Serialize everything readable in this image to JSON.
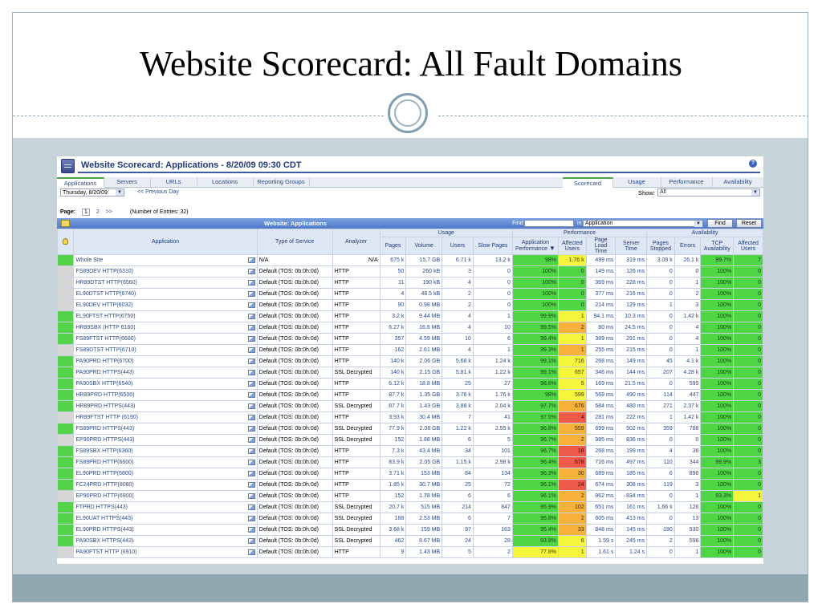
{
  "slide": {
    "title": "Website Scorecard: All Fault Domains"
  },
  "app": {
    "title": "Website Scorecard: Applications - 8/20/09 09:30 CDT",
    "help_icon": "?"
  },
  "tabs": [
    {
      "label": "Applications",
      "active": true
    },
    {
      "label": "Servers"
    },
    {
      "label": "URLs"
    },
    {
      "label": "Locations"
    },
    {
      "label": "Reporting Groups"
    },
    {
      "label": "Scorecard",
      "active": true
    },
    {
      "label": "Usage"
    },
    {
      "label": "Performance"
    },
    {
      "label": "Availability"
    }
  ],
  "toolbar": {
    "date": "Thursday, 8/20/09",
    "prev_day": "<< Previous Day",
    "show_label": "Show:",
    "show_value": "All"
  },
  "pager": {
    "label": "Page:",
    "current": "1",
    "next": "2",
    "more": ">>",
    "entries": "(Number of Entries: 32)"
  },
  "bar": {
    "title": "Website: Applications",
    "find_label": "Find",
    "find_value": "",
    "in_label": "in",
    "in_value": "Application",
    "find_button": "Find",
    "reset_button": "Reset"
  },
  "columns": {
    "groups": {
      "usage": "Usage",
      "performance": "Performance",
      "availability": "Availability"
    },
    "application": "Application",
    "type": "Type of Service",
    "analyzer": "Analyzer",
    "pages": "Pages",
    "volume": "Volume",
    "users": "Users",
    "slow_pages": "Slow Pages",
    "app_perf": "Application Performance",
    "aff_users": "Affected Users",
    "page_load": "Page Load Time",
    "server_time": "Server Time",
    "pages_stopped": "Pages Stopped",
    "errors": "Errors",
    "tcp_avail": "TCP Availability",
    "aff_users2": "Affected Users"
  },
  "colors": {
    "green": "#4fd645",
    "yellow": "#f5f53c",
    "orange": "#f6b13a",
    "red": "#ef5a4a",
    "gray": "#d6d6d6"
  },
  "rows": [
    {
      "ind": "green",
      "app": "Whole Site",
      "type": "N/A",
      "analyzer": "N/A",
      "pages": "675 k",
      "volume": "15.7 GB",
      "users": "6.71 k",
      "slow": "13.2 k",
      "perf": "98%",
      "perf_c": "green",
      "aff": "1.76 k",
      "aff_c": "yellow",
      "load": "499 ms",
      "server": "319 ms",
      "stopped": "3.09 k",
      "errors": "26.1 k",
      "tcp": "99.7%",
      "tcp_c": "green",
      "aff2": "7",
      "aff2_c": "green"
    },
    {
      "ind": "gray",
      "app": "FS89DEV HTTP(6310)",
      "type": "Default (TOS: 0b:0h:0d)",
      "analyzer": "HTTP",
      "pages": "50",
      "volume": "260 kB",
      "users": "3",
      "slow": "0",
      "perf": "100%",
      "perf_c": "green",
      "aff": "0",
      "aff_c": "green",
      "load": "149 ms",
      "server": "126 ms",
      "stopped": "0",
      "errors": "0",
      "tcp": "100%",
      "tcp_c": "green",
      "aff2": "0",
      "aff2_c": "green"
    },
    {
      "ind": "gray",
      "app": "HR89DTST HTTP(6560)",
      "type": "Default (TOS: 0b:0h:0d)",
      "analyzer": "HTTP",
      "pages": "11",
      "volume": "190 kB",
      "users": "4",
      "slow": "0",
      "perf": "100%",
      "perf_c": "green",
      "aff": "0",
      "aff_c": "green",
      "load": "369 ms",
      "server": "228 ms",
      "stopped": "0",
      "errors": "1",
      "tcp": "100%",
      "tcp_c": "green",
      "aff2": "0",
      "aff2_c": "green"
    },
    {
      "ind": "gray",
      "app": "EL90DTST HTTP(6740)",
      "type": "Default (TOS: 0b:0h:0d)",
      "analyzer": "HTTP",
      "pages": "4",
      "volume": "48.5 kB",
      "users": "2",
      "slow": "0",
      "perf": "100%",
      "perf_c": "green",
      "aff": "0",
      "aff_c": "green",
      "load": "377 ms",
      "server": "216 ms",
      "stopped": "0",
      "errors": "2",
      "tcp": "100%",
      "tcp_c": "green",
      "aff2": "0",
      "aff2_c": "green"
    },
    {
      "ind": "gray",
      "app": "EL90DEV HTTP(6032)",
      "type": "Default (TOS: 0b:0h:0d)",
      "analyzer": "HTTP",
      "pages": "90",
      "volume": "0.98 MB",
      "users": "2",
      "slow": "0",
      "perf": "100%",
      "perf_c": "green",
      "aff": "0",
      "aff_c": "green",
      "load": "214 ms",
      "server": "129 ms",
      "stopped": "1",
      "errors": "3",
      "tcp": "100%",
      "tcp_c": "green",
      "aff2": "0",
      "aff2_c": "green"
    },
    {
      "ind": "green",
      "app": "EL90FTST HTTP(6750)",
      "type": "Default (TOS: 0b:0h:0d)",
      "analyzer": "HTTP",
      "pages": "3.2 k",
      "volume": "9.44 MB",
      "users": "4",
      "slow": "1",
      "perf": "99.9%",
      "perf_c": "green",
      "aff": "1",
      "aff_c": "yellow",
      "load": "94.1 ms",
      "server": "10.3 ms",
      "stopped": "0",
      "errors": "1.42 k",
      "tcp": "100%",
      "tcp_c": "green",
      "aff2": "0",
      "aff2_c": "green"
    },
    {
      "ind": "green",
      "app": "HR89SBX (HTTP 6160)",
      "type": "Default (TOS: 0b:0h:0d)",
      "analyzer": "HTTP",
      "pages": "6.27 k",
      "volume": "16.6 MB",
      "users": "4",
      "slow": "10",
      "perf": "99.5%",
      "perf_c": "green",
      "aff": "2",
      "aff_c": "orange",
      "load": "80 ms",
      "server": "24.5 ms",
      "stopped": "0",
      "errors": "4",
      "tcp": "100%",
      "tcp_c": "green",
      "aff2": "0",
      "aff2_c": "green"
    },
    {
      "ind": "green",
      "app": "FS89FTST HTTP(6680)",
      "type": "Default (TOS: 0b:0h:0d)",
      "analyzer": "HTTP",
      "pages": "357",
      "volume": "4.59 MB",
      "users": "10",
      "slow": "6",
      "perf": "99.4%",
      "perf_c": "green",
      "aff": "1",
      "aff_c": "yellow",
      "load": "389 ms",
      "server": "291 ms",
      "stopped": "0",
      "errors": "4",
      "tcp": "100%",
      "tcp_c": "green",
      "aff2": "0",
      "aff2_c": "green"
    },
    {
      "ind": "gray",
      "app": "FS89DTST HTTP(6710)",
      "type": "Default (TOS: 0b:0h:0d)",
      "analyzer": "HTTP",
      "pages": "162",
      "volume": "2.61 MB",
      "users": "4",
      "slow": "1",
      "perf": "99.3%",
      "perf_c": "green",
      "aff": "1",
      "aff_c": "orange",
      "load": "255 ms",
      "server": "215 ms",
      "stopped": "0",
      "errors": "1",
      "tcp": "100%",
      "tcp_c": "green",
      "aff2": "0",
      "aff2_c": "green"
    },
    {
      "ind": "green",
      "app": "PA90PRD HTTP(6700)",
      "type": "Default (TOS: 0b:0h:0d)",
      "analyzer": "HTTP",
      "pages": "140 k",
      "volume": "2.06 GB",
      "users": "5.68 k",
      "slow": "1.24 k",
      "perf": "99.1%",
      "perf_c": "green",
      "aff": "716",
      "aff_c": "yellow",
      "load": "268 ms",
      "server": "149 ms",
      "stopped": "45",
      "errors": "4.1 k",
      "tcp": "100%",
      "tcp_c": "green",
      "aff2": "0",
      "aff2_c": "green"
    },
    {
      "ind": "green",
      "app": "PA90PRD HTTPS(443)",
      "type": "Default (TOS: 0b:0h:0d)",
      "analyzer": "SSL Decrypted",
      "pages": "140 k",
      "volume": "2.15 GB",
      "users": "5.81 k",
      "slow": "1.22 k",
      "perf": "99.1%",
      "perf_c": "green",
      "aff": "657",
      "aff_c": "yellow",
      "load": "346 ms",
      "server": "144 ms",
      "stopped": "207",
      "errors": "4.28 k",
      "tcp": "100%",
      "tcp_c": "green",
      "aff2": "0",
      "aff2_c": "green"
    },
    {
      "ind": "green",
      "app": "PA90SBX HTTP(6540)",
      "type": "Default (TOS: 0b:0h:0d)",
      "analyzer": "HTTP",
      "pages": "6.12 k",
      "volume": "18.8 MB",
      "users": "25",
      "slow": "27",
      "perf": "98.6%",
      "perf_c": "green",
      "aff": "5",
      "aff_c": "yellow",
      "load": "169 ms",
      "server": "21.5 ms",
      "stopped": "0",
      "errors": "595",
      "tcp": "100%",
      "tcp_c": "green",
      "aff2": "0",
      "aff2_c": "green"
    },
    {
      "ind": "green",
      "app": "HR89PRD HTTP(6500)",
      "type": "Default (TOS: 0b:0h:0d)",
      "analyzer": "HTTP",
      "pages": "87.7 k",
      "volume": "1.35 GB",
      "users": "3.76 k",
      "slow": "1.76 k",
      "perf": "98%",
      "perf_c": "green",
      "aff": "599",
      "aff_c": "yellow",
      "load": "569 ms",
      "server": "490 ms",
      "stopped": "114",
      "errors": "447",
      "tcp": "100%",
      "tcp_c": "green",
      "aff2": "0",
      "aff2_c": "green"
    },
    {
      "ind": "green",
      "app": "HR89PRD HTTPS(443)",
      "type": "Default (TOS: 0b:0h:0d)",
      "analyzer": "SSL Decrypted",
      "pages": "87.7 k",
      "volume": "1.43 GB",
      "users": "3.88 k",
      "slow": "2.04 k",
      "perf": "97.7%",
      "perf_c": "green",
      "aff": "676",
      "aff_c": "orange",
      "load": "684 ms",
      "server": "480 ms",
      "stopped": "271",
      "errors": "2.37 k",
      "tcp": "100%",
      "tcp_c": "green",
      "aff2": "0",
      "aff2_c": "green"
    },
    {
      "ind": "gray",
      "app": "HR89FTST HTTP (6190)",
      "type": "Default (TOS: 0b:0h:0d)",
      "analyzer": "HTTP",
      "pages": "3.93 k",
      "volume": "30.4 MB",
      "users": "7",
      "slow": "41",
      "perf": "97.5%",
      "perf_c": "green",
      "aff": "4",
      "aff_c": "red",
      "load": "281 ms",
      "server": "222 ms",
      "stopped": "1",
      "errors": "1.42 k",
      "tcp": "100%",
      "tcp_c": "green",
      "aff2": "0",
      "aff2_c": "green"
    },
    {
      "ind": "green",
      "app": "FS89PRD HTTPS(443)",
      "type": "Default (TOS: 0b:0h:0d)",
      "analyzer": "SSL Decrypted",
      "pages": "77.9 k",
      "volume": "2.08 GB",
      "users": "1.22 k",
      "slow": "2.55 k",
      "perf": "96.8%",
      "perf_c": "green",
      "aff": "559",
      "aff_c": "orange",
      "load": "699 ms",
      "server": "502 ms",
      "stopped": "359",
      "errors": "788",
      "tcp": "100%",
      "tcp_c": "green",
      "aff2": "0",
      "aff2_c": "green"
    },
    {
      "ind": "gray",
      "app": "EP90PRD HTTPS(443)",
      "type": "Default (TOS: 0b:0h:0d)",
      "analyzer": "SSL Decrypted",
      "pages": "152",
      "volume": "1.88 MB",
      "users": "6",
      "slow": "5",
      "perf": "96.7%",
      "perf_c": "green",
      "aff": "2",
      "aff_c": "orange",
      "load": "985 ms",
      "server": "836 ms",
      "stopped": "0",
      "errors": "0",
      "tcp": "100%",
      "tcp_c": "green",
      "aff2": "0",
      "aff2_c": "green"
    },
    {
      "ind": "green",
      "app": "FS89SBX HTTP(6360)",
      "type": "Default (TOS: 0b:0h:0d)",
      "analyzer": "HTTP",
      "pages": "7.3 k",
      "volume": "43.4 MB",
      "users": "34",
      "slow": "101",
      "perf": "96.7%",
      "perf_c": "green",
      "aff": "18",
      "aff_c": "red",
      "load": "268 ms",
      "server": "199 ms",
      "stopped": "4",
      "errors": "36",
      "tcp": "100%",
      "tcp_c": "green",
      "aff2": "0",
      "aff2_c": "green"
    },
    {
      "ind": "green",
      "app": "FS89PRD HTTP(6600)",
      "type": "Default (TOS: 0b:0h:0d)",
      "analyzer": "HTTP",
      "pages": "83.9 k",
      "volume": "2.05 GB",
      "users": "1.15 k",
      "slow": "2.98 k",
      "perf": "96.4%",
      "perf_c": "green",
      "aff": "578",
      "aff_c": "red",
      "load": "716 ms",
      "server": "497 ms",
      "stopped": "110",
      "errors": "344",
      "tcp": "99.9%",
      "tcp_c": "green",
      "aff2": "3",
      "aff2_c": "green"
    },
    {
      "ind": "green",
      "app": "EL90PRD HTTP(6800)",
      "type": "Default (TOS: 0b:0h:0d)",
      "analyzer": "HTTP",
      "pages": "3.71 k",
      "volume": "153 MB",
      "users": "84",
      "slow": "134",
      "perf": "96.3%",
      "perf_c": "green",
      "aff": "30",
      "aff_c": "orange",
      "load": "689 ms",
      "server": "185 ms",
      "stopped": "6",
      "errors": "896",
      "tcp": "100%",
      "tcp_c": "green",
      "aff2": "0",
      "aff2_c": "green"
    },
    {
      "ind": "green",
      "app": "FC24PRD HTTP(8080)",
      "type": "Default (TOS: 0b:0h:0d)",
      "analyzer": "HTTP",
      "pages": "1.85 k",
      "volume": "30.7 MB",
      "users": "25",
      "slow": "72",
      "perf": "96.1%",
      "perf_c": "green",
      "aff": "24",
      "aff_c": "red",
      "load": "674 ms",
      "server": "308 ms",
      "stopped": "119",
      "errors": "3",
      "tcp": "100%",
      "tcp_c": "green",
      "aff2": "0",
      "aff2_c": "green"
    },
    {
      "ind": "gray",
      "app": "EP90PRD HTTP(6900)",
      "type": "Default (TOS: 0b:0h:0d)",
      "analyzer": "HTTP",
      "pages": "152",
      "volume": "1.78 MB",
      "users": "6",
      "slow": "6",
      "perf": "96.1%",
      "perf_c": "green",
      "aff": "2",
      "aff_c": "orange",
      "load": "962 ms",
      "server": "834 ms",
      "stopped": "0",
      "errors": "1",
      "tcp": "93.3%",
      "tcp_c": "green",
      "aff2": "1",
      "aff2_c": "yellow"
    },
    {
      "ind": "green",
      "app": "FTPRD HTTPS(443)",
      "type": "Default (TOS: 0b:0h:0d)",
      "analyzer": "SSL Decrypted",
      "pages": "20.7 k",
      "volume": "515 MB",
      "users": "214",
      "slow": "847",
      "perf": "95.9%",
      "perf_c": "green",
      "aff": "102",
      "aff_c": "orange",
      "load": "651 ms",
      "server": "161 ms",
      "stopped": "1.66 k",
      "errors": "126",
      "tcp": "100%",
      "tcp_c": "green",
      "aff2": "0",
      "aff2_c": "green"
    },
    {
      "ind": "green",
      "app": "EL90UAT HTTPS(443)",
      "type": "Default (TOS: 0b:0h:0d)",
      "analyzer": "SSL Decrypted",
      "pages": "168",
      "volume": "2.53 MB",
      "users": "6",
      "slow": "7",
      "perf": "95.8%",
      "perf_c": "green",
      "aff": "2",
      "aff_c": "orange",
      "load": "605 ms",
      "server": "413 ms",
      "stopped": "0",
      "errors": "13",
      "tcp": "100%",
      "tcp_c": "green",
      "aff2": "0",
      "aff2_c": "green"
    },
    {
      "ind": "green",
      "app": "EL90PRD HTTPS(443)",
      "type": "Default (TOS: 0b:0h:0d)",
      "analyzer": "SSL Decrypted",
      "pages": "3.68 k",
      "volume": "159 MB",
      "users": "97",
      "slow": "163",
      "perf": "95.4%",
      "perf_c": "green",
      "aff": "33",
      "aff_c": "orange",
      "load": "848 ms",
      "server": "145 ms",
      "stopped": "190",
      "errors": "930",
      "tcp": "100%",
      "tcp_c": "green",
      "aff2": "0",
      "aff2_c": "green"
    },
    {
      "ind": "green",
      "app": "PA90SBX HTTPS(443)",
      "type": "Default (TOS: 0b:0h:0d)",
      "analyzer": "SSL Decrypted",
      "pages": "462",
      "volume": "8.67 MB",
      "users": "24",
      "slow": "28",
      "perf": "93.8%",
      "perf_c": "green",
      "aff": "6",
      "aff_c": "yellow",
      "load": "1.59 s",
      "server": "245 ms",
      "stopped": "2",
      "errors": "596",
      "tcp": "100%",
      "tcp_c": "green",
      "aff2": "0",
      "aff2_c": "green"
    },
    {
      "ind": "gray",
      "app": "PA90FTST HTTP (6910)",
      "type": "Default (TOS: 0b:0h:0d)",
      "analyzer": "HTTP",
      "pages": "9",
      "volume": "1.43 MB",
      "users": "5",
      "slow": "2",
      "perf": "77.8%",
      "perf_c": "yellow",
      "aff": "1",
      "aff_c": "yellow",
      "load": "1.61 s",
      "server": "1.24 s",
      "stopped": "0",
      "errors": "1",
      "tcp": "100%",
      "tcp_c": "green",
      "aff2": "0",
      "aff2_c": "green"
    }
  ]
}
